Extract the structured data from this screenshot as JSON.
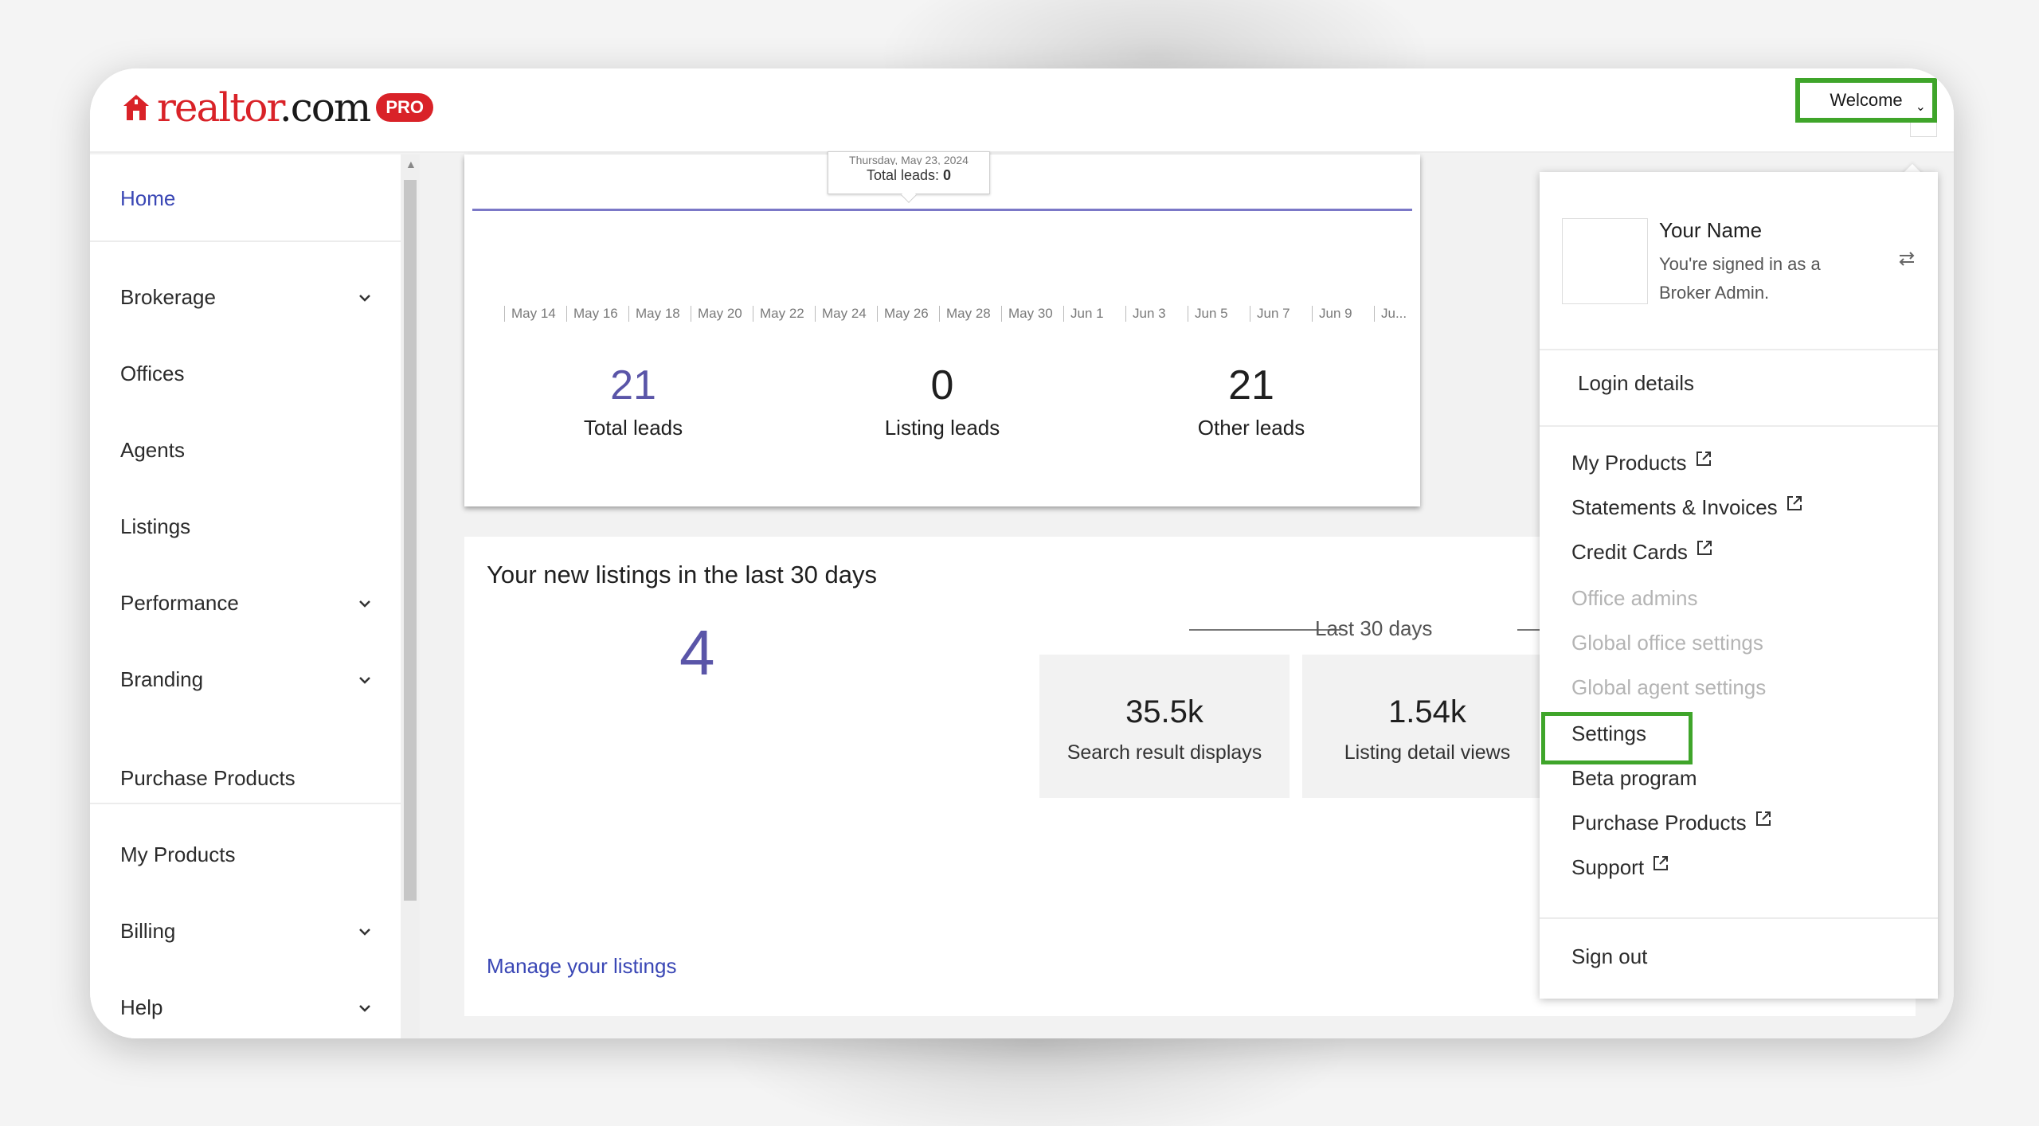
{
  "header": {
    "logo_main": "realtor",
    "logo_suffix": ".com",
    "badge": "PRO",
    "welcome_label": "Welcome"
  },
  "sidebar": {
    "items": [
      {
        "label": "Home"
      },
      {
        "label": "Brokerage"
      },
      {
        "label": "Offices"
      },
      {
        "label": "Agents"
      },
      {
        "label": "Listings"
      },
      {
        "label": "Performance"
      },
      {
        "label": "Branding"
      },
      {
        "label": "Purchase Products"
      },
      {
        "label": "My Products"
      },
      {
        "label": "Billing"
      },
      {
        "label": "Help"
      }
    ]
  },
  "leads": {
    "tooltip_date": "Thursday, May 23, 2024",
    "tooltip_label": "Total leads:",
    "tooltip_value": "0",
    "ticks": [
      "May 14",
      "May 16",
      "May 18",
      "May 20",
      "May 22",
      "May 24",
      "May 26",
      "May 28",
      "May 30",
      "Jun 1",
      "Jun 3",
      "Jun 5",
      "Jun 7",
      "Jun 9",
      "Ju..."
    ],
    "total_value": "21",
    "total_label": "Total leads",
    "listing_value": "0",
    "listing_label": "Listing leads",
    "other_value": "21",
    "other_label": "Other leads"
  },
  "listings": {
    "title": "Your new listings in the last 30 days",
    "count": "4",
    "period_label": "Last 30 days",
    "search_value": "35.5k",
    "search_label": "Search result displays",
    "detail_value": "1.54k",
    "detail_label": "Listing detail views",
    "manage_link": "Manage your listings"
  },
  "dropdown": {
    "user_name": "Your Name",
    "user_role": "You're signed in as a Broker Admin.",
    "login_details": "Login details",
    "items": [
      {
        "label": "My Products"
      },
      {
        "label": "Statements & Invoices"
      },
      {
        "label": "Credit Cards"
      },
      {
        "label": "Office admins"
      },
      {
        "label": "Global office settings"
      },
      {
        "label": "Global agent settings"
      },
      {
        "label": "Settings"
      },
      {
        "label": "Beta program"
      },
      {
        "label": "Purchase Products"
      },
      {
        "label": "Support"
      }
    ],
    "sign_out": "Sign out"
  },
  "colors": {
    "brand_red": "#d92228",
    "link_blue": "#3a47b5",
    "accent_purple": "#5a55a8",
    "highlight_green": "#3fa52a"
  }
}
